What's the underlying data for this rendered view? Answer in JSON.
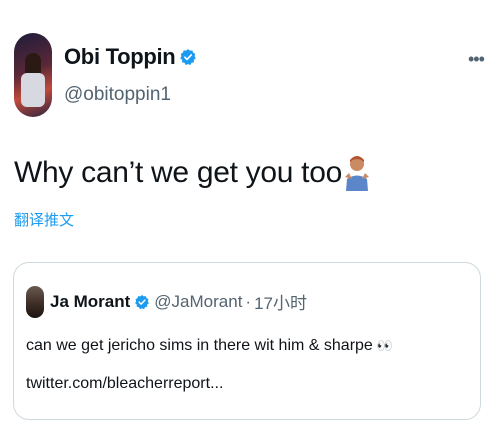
{
  "tweet": {
    "author": {
      "display_name": "Obi Toppin",
      "handle": "@obitoppin1",
      "verified": true
    },
    "more_icon": "more-horizontal-icon",
    "text": "Why can’t we get you too",
    "emoji": "person-shrugging-emoji",
    "translate_label": "翻译推文"
  },
  "quote": {
    "author": {
      "display_name": "Ja Morant",
      "handle": "@JaMorant",
      "verified": true
    },
    "separator": "·",
    "time": "17小时",
    "text": "can we get jericho sims in there wit him & sharpe",
    "text_emoji": "👀",
    "link": "twitter.com/bleacherreport..."
  },
  "colors": {
    "verified": "#1d9bf0",
    "link": "#1d9bf0",
    "secondary_text": "#536471",
    "border": "#cfd9de"
  }
}
